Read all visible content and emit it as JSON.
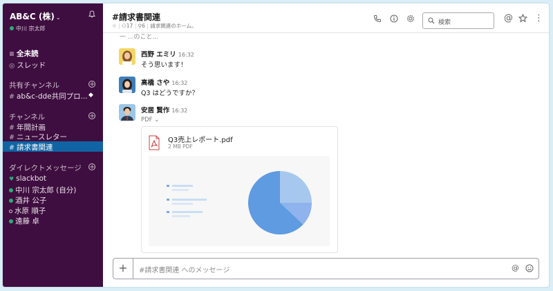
{
  "workspace": {
    "name": "AB&C (株)",
    "caret": "⌄",
    "user": "中川 宗太郎"
  },
  "nav": {
    "all_unread": "全未読",
    "threads": "スレッド"
  },
  "shared_channels": {
    "heading": "共有チャンネル",
    "items": [
      {
        "prefix": "#",
        "label": "ab&c-dde共同プロ..."
      }
    ]
  },
  "channels": {
    "heading": "チャンネル",
    "items": [
      {
        "prefix": "#",
        "label": "年間計画"
      },
      {
        "prefix": "#",
        "label": "ニュースレター"
      },
      {
        "prefix": "#",
        "label": "請求書関連"
      }
    ]
  },
  "direct_messages": {
    "heading": "ダイレクトメッセージ",
    "items": [
      {
        "label": "slackbot",
        "status": "bot"
      },
      {
        "label": "中川 宗太郎 (自分)",
        "status": "online"
      },
      {
        "label": "酒井 公子",
        "status": "online"
      },
      {
        "label": "水原 順子",
        "status": "away"
      },
      {
        "label": "遠藤 卓",
        "status": "online"
      }
    ]
  },
  "header": {
    "title": "#請求書関連",
    "star": "☆",
    "members": "17",
    "pins": "6",
    "topic": "請求関連のホーム。",
    "search_placeholder": "検索",
    "at": "@",
    "more": "⋮"
  },
  "messages": {
    "truncated_text": "一 ...のこと...",
    "items": [
      {
        "name": "西野 エミリ",
        "time": "16:32",
        "text": "そう思います！"
      },
      {
        "name": "高橋 さや",
        "time": "16:32",
        "text": "Q3 はどうですか？"
      },
      {
        "name": "安居 賢作",
        "time": "16:32",
        "text": ""
      }
    ],
    "pdf_label": "PDF ⌄",
    "file": {
      "name": "Q3売上レポート.pdf",
      "meta": "2 MB PDF"
    }
  },
  "pie_slices": [
    {
      "share": 0.25,
      "color": "#a7c8ee"
    },
    {
      "share": 0.12,
      "color": "#8fb3ec"
    },
    {
      "share": 0.63,
      "color": "#5f9be0"
    }
  ],
  "composer": {
    "plus": "+",
    "placeholder": "#請求書関連 へのメッセージ",
    "at": "@"
  },
  "colors": {
    "sidebar_bg": "#3f0e40",
    "active_channel": "#1164a3",
    "online": "#2bac76"
  }
}
